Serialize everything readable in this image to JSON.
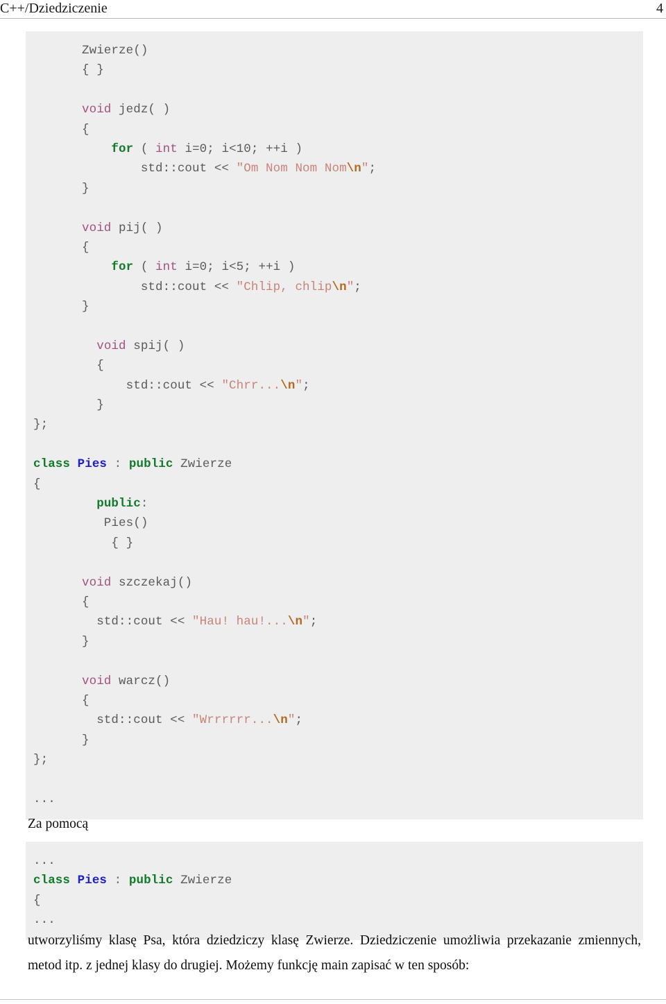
{
  "header": {
    "title": "C++/Dziedziczenie",
    "page_number": "4"
  },
  "code_block_1": {
    "lines": [
      [
        {
          "t": "Zwierze()",
          "c": "plain"
        }
      ],
      [
        {
          "t": "{ }",
          "c": "plain"
        }
      ],
      [
        {
          "t": "",
          "c": "plain"
        }
      ],
      [
        {
          "t": "void",
          "c": "type"
        },
        {
          "t": " jedz( )",
          "c": "plain"
        }
      ],
      [
        {
          "t": "{",
          "c": "plain"
        }
      ],
      [
        {
          "t": "    ",
          "c": "plain"
        },
        {
          "t": "for",
          "c": "kw"
        },
        {
          "t": " ( ",
          "c": "plain"
        },
        {
          "t": "int",
          "c": "type"
        },
        {
          "t": " i=0; i<10; ++i )",
          "c": "plain"
        }
      ],
      [
        {
          "t": "        std::cout << ",
          "c": "plain"
        },
        {
          "t": "\"Om Nom Nom Nom",
          "c": "str"
        },
        {
          "t": "\\n",
          "c": "esc"
        },
        {
          "t": "\"",
          "c": "str"
        },
        {
          "t": ";",
          "c": "plain"
        }
      ],
      [
        {
          "t": "}",
          "c": "plain"
        }
      ],
      [
        {
          "t": "",
          "c": "plain"
        }
      ],
      [
        {
          "t": "void",
          "c": "type"
        },
        {
          "t": " pij( )",
          "c": "plain"
        }
      ],
      [
        {
          "t": "{",
          "c": "plain"
        }
      ],
      [
        {
          "t": "    ",
          "c": "plain"
        },
        {
          "t": "for",
          "c": "kw"
        },
        {
          "t": " ( ",
          "c": "plain"
        },
        {
          "t": "int",
          "c": "type"
        },
        {
          "t": " i=0; i<5; ++i )",
          "c": "plain"
        }
      ],
      [
        {
          "t": "        std::cout << ",
          "c": "plain"
        },
        {
          "t": "\"Chlip, chlip",
          "c": "str"
        },
        {
          "t": "\\n",
          "c": "esc"
        },
        {
          "t": "\"",
          "c": "str"
        },
        {
          "t": ";",
          "c": "plain"
        }
      ],
      [
        {
          "t": "}",
          "c": "plain"
        }
      ],
      [
        {
          "t": "",
          "c": "plain"
        }
      ],
      [
        {
          "t": "  ",
          "c": "plain"
        },
        {
          "t": "void",
          "c": "type"
        },
        {
          "t": " spij( )",
          "c": "plain"
        }
      ],
      [
        {
          "t": "  {",
          "c": "plain"
        }
      ],
      [
        {
          "t": "      std::cout << ",
          "c": "plain"
        },
        {
          "t": "\"Chrr...",
          "c": "str"
        },
        {
          "t": "\\n",
          "c": "esc"
        },
        {
          "t": "\"",
          "c": "str"
        },
        {
          "t": ";",
          "c": "plain"
        }
      ],
      [
        {
          "t": "  }",
          "c": "plain"
        }
      ],
      [
        {
          "t": "};",
          "c": "plain",
          "outdent": true
        }
      ],
      [
        {
          "t": "",
          "c": "plain"
        }
      ],
      [
        {
          "t": "class",
          "c": "kw",
          "outdent": true
        },
        {
          "t": " ",
          "c": "plain"
        },
        {
          "t": "Pies",
          "c": "cls"
        },
        {
          "t": " : ",
          "c": "punct"
        },
        {
          "t": "public",
          "c": "kw"
        },
        {
          "t": " Zwierze",
          "c": "plain"
        }
      ],
      [
        {
          "t": "{",
          "c": "plain",
          "outdent": true
        }
      ],
      [
        {
          "t": "  ",
          "c": "plain"
        },
        {
          "t": "public",
          "c": "kw"
        },
        {
          "t": ":",
          "c": "punct"
        }
      ],
      [
        {
          "t": "   Pies()",
          "c": "plain"
        }
      ],
      [
        {
          "t": "    { }",
          "c": "plain"
        }
      ],
      [
        {
          "t": "",
          "c": "plain"
        }
      ],
      [
        {
          "t": "void",
          "c": "type"
        },
        {
          "t": " szczekaj()",
          "c": "plain"
        }
      ],
      [
        {
          "t": "{",
          "c": "plain"
        }
      ],
      [
        {
          "t": "  std::cout << ",
          "c": "plain"
        },
        {
          "t": "\"Hau! hau!...",
          "c": "str"
        },
        {
          "t": "\\n",
          "c": "esc"
        },
        {
          "t": "\"",
          "c": "str"
        },
        {
          "t": ";",
          "c": "plain"
        }
      ],
      [
        {
          "t": "}",
          "c": "plain"
        }
      ],
      [
        {
          "t": "",
          "c": "plain"
        }
      ],
      [
        {
          "t": "void",
          "c": "type"
        },
        {
          "t": " warcz()",
          "c": "plain"
        }
      ],
      [
        {
          "t": "{",
          "c": "plain"
        }
      ],
      [
        {
          "t": "  std::cout << ",
          "c": "plain"
        },
        {
          "t": "\"Wrrrrrr...",
          "c": "str"
        },
        {
          "t": "\\n",
          "c": "esc"
        },
        {
          "t": "\"",
          "c": "str"
        },
        {
          "t": ";",
          "c": "plain"
        }
      ],
      [
        {
          "t": "}",
          "c": "plain"
        }
      ],
      [
        {
          "t": "};",
          "c": "plain",
          "outdent": true
        }
      ],
      [
        {
          "t": "",
          "c": "plain"
        }
      ],
      [
        {
          "t": "...",
          "c": "dots",
          "outdent": true
        }
      ]
    ]
  },
  "prose_1": "Za pomocą",
  "code_block_2": {
    "lines": [
      [
        {
          "t": "...",
          "c": "dots",
          "outdent": true
        }
      ],
      [
        {
          "t": "class",
          "c": "kw",
          "outdent": true
        },
        {
          "t": " ",
          "c": "plain"
        },
        {
          "t": "Pies",
          "c": "cls"
        },
        {
          "t": " : ",
          "c": "punct"
        },
        {
          "t": "public",
          "c": "kw"
        },
        {
          "t": " Zwierze",
          "c": "plain"
        }
      ],
      [
        {
          "t": "{",
          "c": "plain",
          "outdent": true
        }
      ],
      [
        {
          "t": "...",
          "c": "dots",
          "outdent": true
        }
      ]
    ]
  },
  "prose_2": "utworzyliśmy klasę Psa, która dziedziczy klasę Zwierze. Dziedziczenie umożliwia przekazanie zmiennych, metod itp. z jednej klasy do drugiej. Możemy funkcję main zapisać w ten sposób:"
}
